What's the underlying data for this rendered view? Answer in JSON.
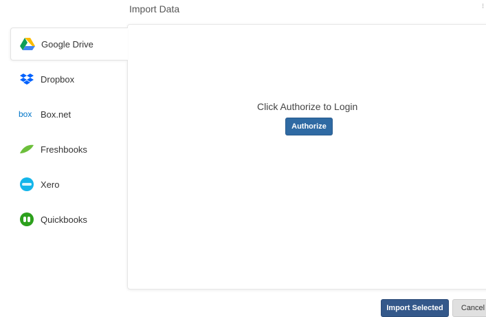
{
  "dialog": {
    "title": "Import Data",
    "close_glyph": "⁝"
  },
  "sidebar": {
    "items": [
      {
        "label": "Google Drive",
        "icon": "google-drive-icon",
        "active": true
      },
      {
        "label": "Dropbox",
        "icon": "dropbox-icon",
        "active": false
      },
      {
        "label": "Box.net",
        "icon": "box-net-icon",
        "active": false
      },
      {
        "label": "Freshbooks",
        "icon": "freshbooks-icon",
        "active": false
      },
      {
        "label": "Xero",
        "icon": "xero-icon",
        "active": false
      },
      {
        "label": "Quickbooks",
        "icon": "quickbooks-icon",
        "active": false
      }
    ]
  },
  "main": {
    "prompt": "Click Authorize to Login",
    "authorize_label": "Authorize"
  },
  "footer": {
    "import_selected_label": "Import Selected",
    "cancel_label": "Cancel"
  },
  "colors": {
    "primary_button": "#2f6aa3",
    "import_button": "#34588a",
    "cancel_button": "#e0e0e0",
    "dropbox_blue": "#0061fe",
    "box_blue": "#0075c9",
    "freshbooks_green": "#6cbf3b",
    "xero_blue": "#13b5ea",
    "quickbooks_green": "#2ca01c"
  }
}
